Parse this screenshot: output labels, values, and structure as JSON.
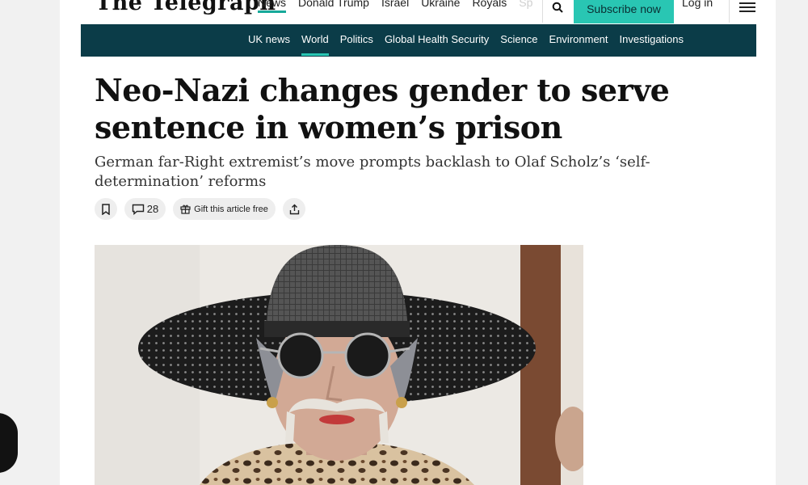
{
  "site": {
    "logo_text": "The Telegraph",
    "top_nav": [
      "News",
      "Donald Trump",
      "Israel",
      "Ukraine",
      "Royals",
      "Sp"
    ],
    "subscribe_label": "Subscribe now",
    "login_label": "Log in"
  },
  "section_nav": [
    "UK news",
    "World",
    "Politics",
    "Global Health Security",
    "Science",
    "Environment",
    "Investigations"
  ],
  "article": {
    "headline": "Neo-Nazi changes gender to serve sentence in women’s prison",
    "standfirst": "German far-Right extremist’s move prompts backlash to Olaf Scholz’s ‘self-determination’ reforms",
    "comment_count": "28",
    "gift_label": "Gift this article free"
  },
  "colors": {
    "accent": "#29c6b3",
    "nav_bg": "#0b3c48"
  },
  "icons": [
    "search-icon",
    "menu-icon",
    "bookmark-icon",
    "comment-icon",
    "gift-icon",
    "share-icon"
  ]
}
